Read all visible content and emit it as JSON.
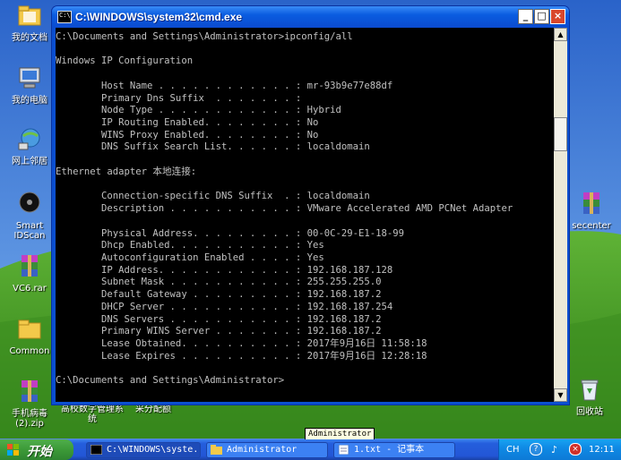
{
  "desktop": {
    "icons": [
      {
        "label": "我的文档"
      },
      {
        "label": "我的电脑"
      },
      {
        "label": "网上邻居"
      },
      {
        "label": "Smart IDScan"
      },
      {
        "label": "VC6.rar"
      },
      {
        "label": "Common"
      },
      {
        "label": "手机病毒(2).zip"
      },
      {
        "label": "高校数字管理系统"
      },
      {
        "label": "采分配额"
      },
      {
        "label": "回收站"
      },
      {
        "label": "secenter"
      }
    ]
  },
  "window": {
    "title": "C:\\WINDOWS\\system32\\cmd.exe",
    "icon_text": "C:\\",
    "buttons": {
      "minimize": "_",
      "maximize": "□",
      "close": "×"
    }
  },
  "console": {
    "text": "C:\\Documents and Settings\\Administrator>ipconfig/all\n\nWindows IP Configuration\n\n        Host Name . . . . . . . . . . . . : mr-93b9e77e88df\n        Primary Dns Suffix  . . . . . . . :\n        Node Type . . . . . . . . . . . . : Hybrid\n        IP Routing Enabled. . . . . . . . : No\n        WINS Proxy Enabled. . . . . . . . : No\n        DNS Suffix Search List. . . . . . : localdomain\n\nEthernet adapter 本地连接:\n\n        Connection-specific DNS Suffix  . : localdomain\n        Description . . . . . . . . . . . : VMware Accelerated AMD PCNet Adapter\n\n        Physical Address. . . . . . . . . : 00-0C-29-E1-18-99\n        Dhcp Enabled. . . . . . . . . . . : Yes\n        Autoconfiguration Enabled . . . . : Yes\n        IP Address. . . . . . . . . . . . : 192.168.187.128\n        Subnet Mask . . . . . . . . . . . : 255.255.255.0\n        Default Gateway . . . . . . . . . : 192.168.187.2\n        DHCP Server . . . . . . . . . . . : 192.168.187.254\n        DNS Servers . . . . . . . . . . . : 192.168.187.2\n        Primary WINS Server . . . . . . . : 192.168.187.2\n        Lease Obtained. . . . . . . . . . : 2017年9月16日 11:58:18\n        Lease Expires . . . . . . . . . . : 2017年9月16日 12:28:18\n\nC:\\Documents and Settings\\Administrator>"
  },
  "tooltip": {
    "text": "Administrator"
  },
  "taskbar": {
    "start_label": "开始",
    "items": [
      {
        "label": "C:\\WINDOWS\\syste..."
      },
      {
        "label": "Administrator"
      },
      {
        "label": "1.txt - 记事本"
      }
    ],
    "tray": {
      "lang": "CH",
      "time": "12:11"
    }
  },
  "colors": {
    "start_green": "#3c9a38",
    "taskbar_blue": "#245edc",
    "title_blue": "#0a5ce0",
    "console_bg": "#000000",
    "console_fg": "#c0c0c0"
  }
}
